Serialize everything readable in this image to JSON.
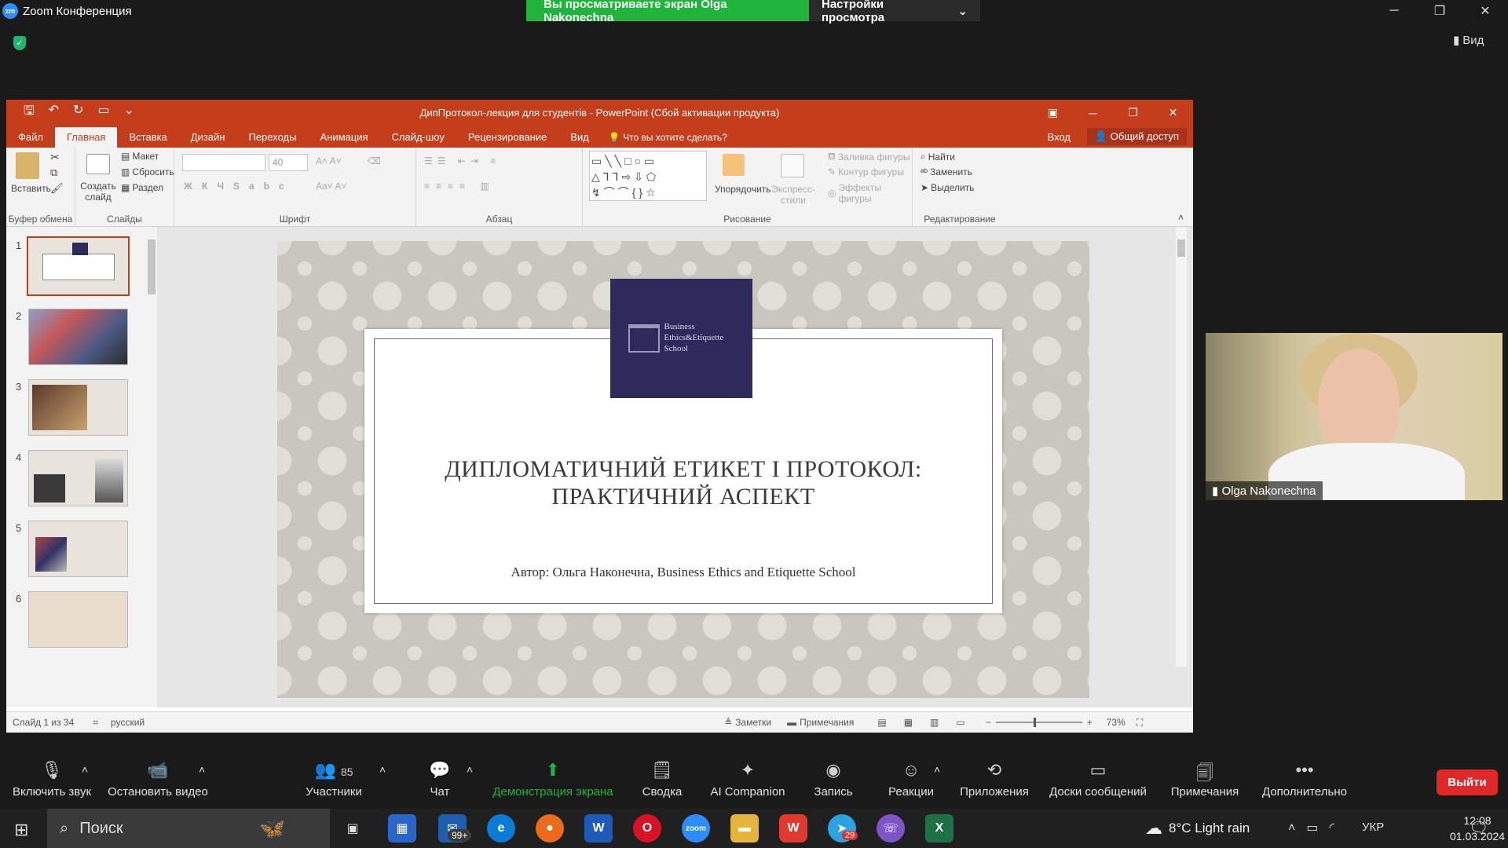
{
  "zoom": {
    "logo": "zm",
    "title": "Zoom Конференция",
    "share_banner": "Вы просматриваете экран Olga Nakonechna",
    "view_settings": "Настройки просмотра",
    "view_button": "Вид"
  },
  "ppt": {
    "title": "ДипПротокол-лекция для студентів - PowerPoint (Сбой активации продукта)",
    "tabs": [
      "Файл",
      "Главная",
      "Вставка",
      "Дизайн",
      "Переходы",
      "Анимация",
      "Слайд-шоу",
      "Рецензирование",
      "Вид"
    ],
    "tell_me": "Что вы хотите сделать?",
    "sign_in": "Вход",
    "share": "Общий доступ",
    "ribbon": {
      "paste": "Вставить",
      "clipboard": "Буфер обмена",
      "new_slide": "Создать слайд",
      "layout": "Макет",
      "reset": "Сбросить",
      "section": "Раздел",
      "slides": "Слайды",
      "font_size": "40",
      "font": "Шрифт",
      "paragraph": "Абзац",
      "arrange": "Упорядочить",
      "quick_styles": "Экспресс-стили",
      "shape_fill": "Заливка фигуры",
      "shape_outline": "Контур фигуры",
      "shape_effects": "Эффекты фигуры",
      "drawing": "Рисование",
      "find": "Найти",
      "replace": "Заменить",
      "select": "Выделить",
      "editing": "Редактирование"
    },
    "thumbnails": [
      "1",
      "2",
      "3",
      "4",
      "5",
      "6"
    ],
    "slide": {
      "logo_text": "Business Ethics&Etiquette School",
      "title_line1": "ДИПЛОМАТИЧНИЙ ЕТИКЕТ І ПРОТОКОЛ:",
      "title_line2": "ПРАКТИЧНИЙ АСПЕКТ",
      "author": "Автор: Ольга Наконечна,  Business Ethics and Etiquette School"
    },
    "status": {
      "slide_info": "Слайд 1 из 34",
      "language": "русский",
      "notes": "Заметки",
      "comments": "Примечания",
      "zoom": "73%"
    }
  },
  "participant": {
    "name": "Olga Nakonechna"
  },
  "toolbar": {
    "unmute": "Включить звук",
    "stop_video": "Остановить видео",
    "participants": "Участники",
    "participants_count": "85",
    "chat": "Чат",
    "share_screen": "Демонстрация экрана",
    "summary": "Сводка",
    "ai": "AI Companion",
    "record": "Запись",
    "reactions": "Реакции",
    "apps": "Приложения",
    "whiteboards": "Доски сообщений",
    "notes": "Примечания",
    "more": "Дополнительно",
    "leave": "Выйти"
  },
  "taskbar": {
    "search": "Поиск",
    "mail_badge": "99+",
    "telegram_badge": "29",
    "weather": "8°C  Light rain",
    "lang": "УКР",
    "time": "12:08",
    "date": "01.03.2024"
  }
}
